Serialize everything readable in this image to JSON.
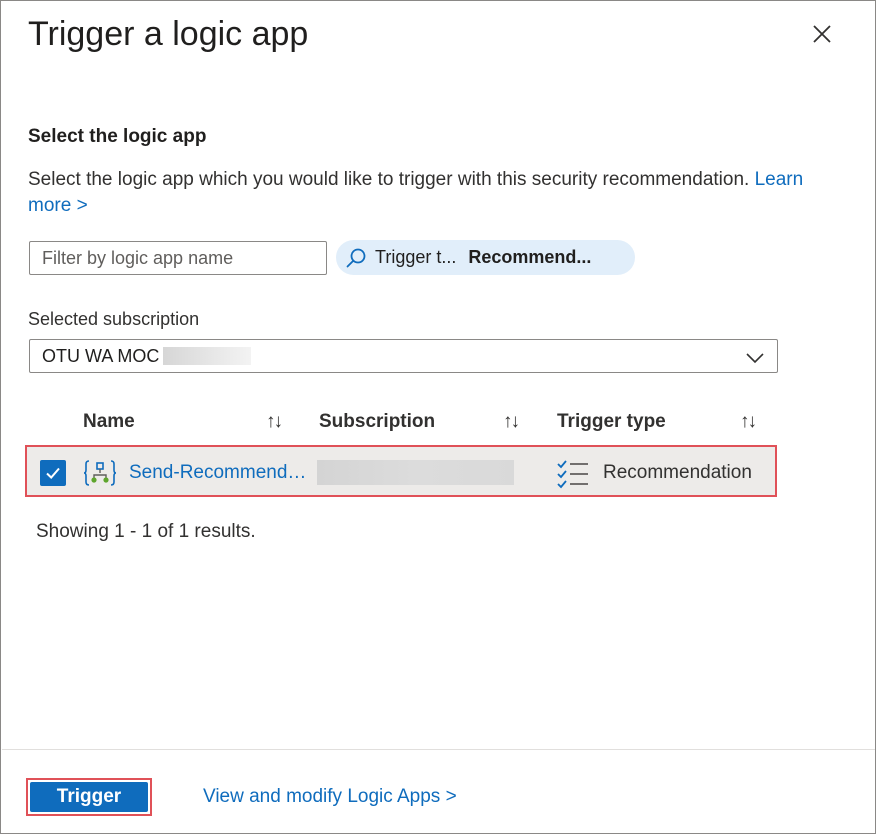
{
  "panel": {
    "title": "Trigger a logic app",
    "close_icon": "close-icon"
  },
  "section": {
    "title": "Select the logic app",
    "description": "Select the logic app which you would like to trigger with this security recommendation.",
    "learn_more": "Learn more >"
  },
  "filter": {
    "placeholder": "Filter by logic app name",
    "value": ""
  },
  "filter_pill": {
    "icon": "search-icon",
    "label": "Trigger t...",
    "value": "Recommend..."
  },
  "subscription": {
    "label": "Selected subscription",
    "selected": "OTU WA MOC"
  },
  "table": {
    "columns": [
      {
        "label": "Name",
        "sort_icon": "↑↓"
      },
      {
        "label": "Subscription",
        "sort_icon": "↑↓"
      },
      {
        "label": "Trigger type",
        "sort_icon": "↑↓"
      }
    ],
    "rows": [
      {
        "selected": true,
        "name": "Send-Recommendation",
        "subscription": "",
        "trigger_type": "Recommendation"
      }
    ]
  },
  "results_text": "Showing 1 - 1 of 1 results.",
  "footer": {
    "trigger_label": "Trigger",
    "view_link": "View and modify Logic Apps >"
  },
  "colors": {
    "accent": "#0f6cbd",
    "highlight_border": "#e05158",
    "pill_bg": "#e1eefa",
    "selected_row_bg": "#edebe9"
  }
}
